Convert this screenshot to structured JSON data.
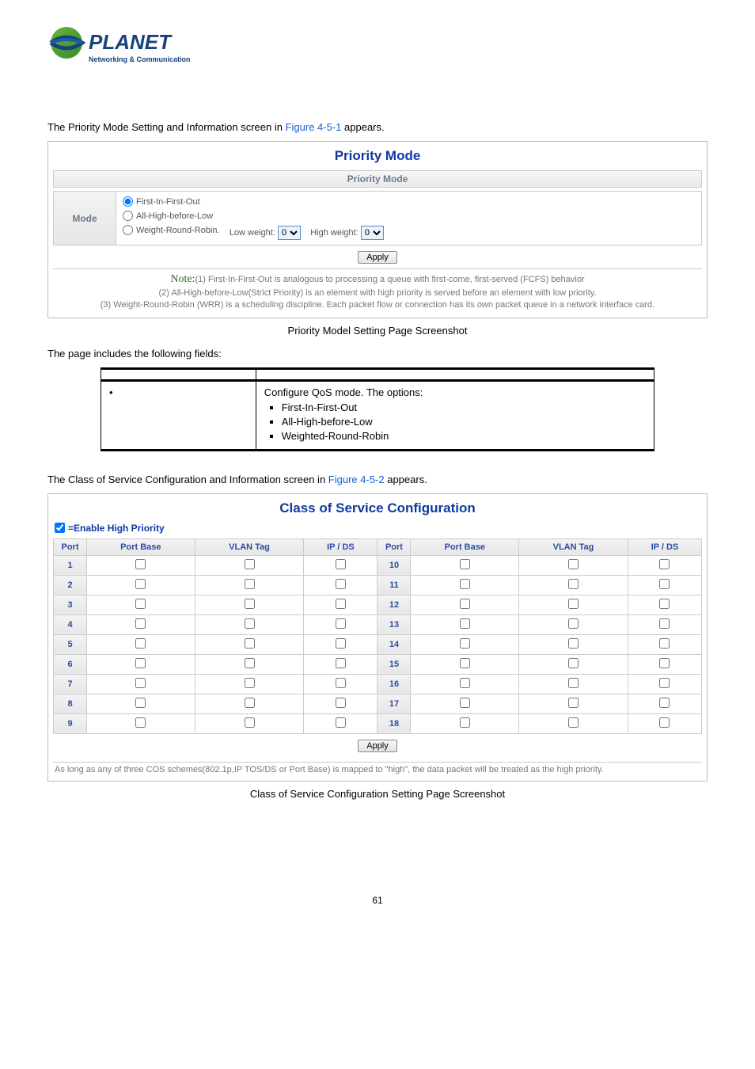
{
  "logo_tagline": "Networking & Communication",
  "section1_intro_prefix": "The Priority Mode Setting and Information screen in ",
  "section1_figref": "Figure 4-5-1",
  "section1_intro_suffix": " appears.",
  "priority_panel": {
    "title": "Priority Mode",
    "subhead": "Priority Mode",
    "mode_label": "Mode",
    "opts": {
      "fifo": "First-In-First-Out",
      "ahbl": "All-High-before-Low",
      "wrr": "Weight-Round-Robin.",
      "low_label": "Low weight:",
      "high_label": "High weight:",
      "low_val": "0",
      "high_val": "0"
    },
    "apply": "Apply",
    "note_label": "Note:",
    "note_1": "(1) First-In-First-Out is analogous to processing a queue with first-come, first-served (FCFS) behavior",
    "note_2": "(2) All-High-before-Low(Strict Priority) is an element with high priority is served before an element with low priority.",
    "note_3": "(3) Weight-Round-Robin (WRR) is a scheduling discipline. Each packet flow or connection has its own packet queue in a network interface card."
  },
  "caption1": "Priority Model Setting Page Screenshot",
  "fields_intro": "The page includes the following fields:",
  "obj_table": {
    "head_obj": "",
    "head_desc": "",
    "row_obj": "",
    "row_desc_lead": "Configure QoS mode. The options:",
    "row_desc_items": {
      "a": "First-In-First-Out",
      "b": "All-High-before-Low",
      "c": "Weighted-Round-Robin"
    }
  },
  "section2_intro_prefix": "The Class of Service Configuration and Information screen in ",
  "section2_figref": "Figure 4-5-2",
  "section2_intro_suffix": " appears.",
  "cos_panel": {
    "title": "Class of Service Configuration",
    "enable_label": "=Enable High Priority",
    "headers": {
      "port": "Port",
      "portbase": "Port Base",
      "vlan": "VLAN Tag",
      "ipds": "IP / DS"
    },
    "left_ports": {
      "p1": "1",
      "p2": "2",
      "p3": "3",
      "p4": "4",
      "p5": "5",
      "p6": "6",
      "p7": "7",
      "p8": "8",
      "p9": "9"
    },
    "right_ports": {
      "p1": "10",
      "p2": "11",
      "p3": "12",
      "p4": "13",
      "p5": "14",
      "p6": "15",
      "p7": "16",
      "p8": "17",
      "p9": "18"
    },
    "apply": "Apply",
    "footer": "As long as any of three COS schemes(802.1p,IP TOS/DS or Port Base) is mapped to \"high\", the data packet will be treated as the high priority."
  },
  "caption2": "Class of Service Configuration Setting Page Screenshot",
  "page_number": "61"
}
